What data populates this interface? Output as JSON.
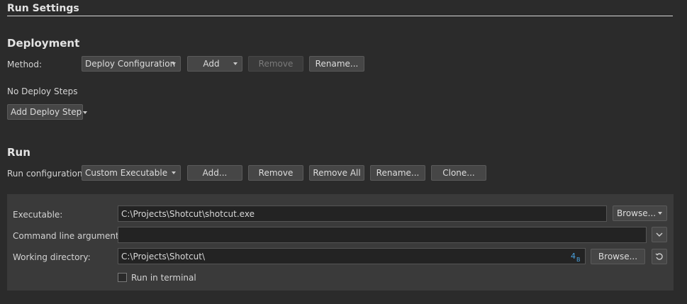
{
  "title": "Run Settings",
  "deployment": {
    "heading": "Deployment",
    "method_label": "Method:",
    "method_value": "Deploy Configuration",
    "add_label": "Add",
    "remove_label": "Remove",
    "rename_label": "Rename...",
    "no_steps_text": "No Deploy Steps",
    "add_step_label": "Add Deploy Step"
  },
  "run": {
    "heading": "Run",
    "config_label": "Run configuration:",
    "config_value": "Custom Executable",
    "add_label": "Add...",
    "remove_label": "Remove",
    "remove_all_label": "Remove All",
    "rename_label": "Rename...",
    "clone_label": "Clone..."
  },
  "executable": {
    "label": "Executable:",
    "value": "C:\\Projects\\Shotcut\\shotcut.exe",
    "browse_label": "Browse..."
  },
  "arguments": {
    "label": "Command line arguments:",
    "value": ""
  },
  "working_dir": {
    "label": "Working directory:",
    "value": "C:\\Projects\\Shotcut\\",
    "browse_label": "Browse..."
  },
  "terminal": {
    "label": "Run in terminal",
    "checked": false
  },
  "icons": {
    "variables": "variables-icon",
    "reset": "reset-icon",
    "expand": "chevron-down-icon"
  },
  "colors": {
    "background": "#2b2b2b",
    "panel": "#3a3a3a",
    "button": "#464646",
    "field": "#232323",
    "accent_icon": "#4aa3e0"
  }
}
